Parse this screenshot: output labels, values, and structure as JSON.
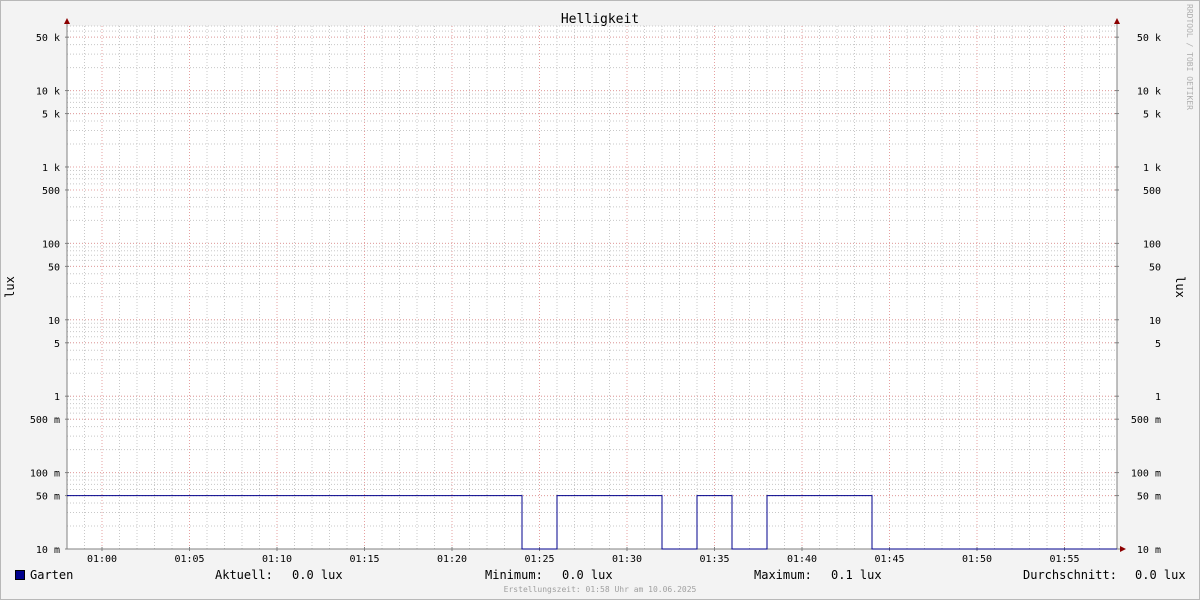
{
  "chart_data": {
    "type": "line",
    "title": "Helligkeit",
    "ylabel_left": "lux",
    "ylabel_right": "lux",
    "y_scale": "log",
    "ylim": [
      0.01,
      70000
    ],
    "y_ticks": [
      {
        "value": 0.01,
        "label": "10 m"
      },
      {
        "value": 0.05,
        "label": "50 m"
      },
      {
        "value": 0.1,
        "label": "100 m"
      },
      {
        "value": 0.5,
        "label": "500 m"
      },
      {
        "value": 1,
        "label": "1"
      },
      {
        "value": 5,
        "label": "5"
      },
      {
        "value": 10,
        "label": "10"
      },
      {
        "value": 50,
        "label": "50"
      },
      {
        "value": 100,
        "label": "100"
      },
      {
        "value": 500,
        "label": "500"
      },
      {
        "value": 1000,
        "label": "1 k"
      },
      {
        "value": 5000,
        "label": "5 k"
      },
      {
        "value": 10000,
        "label": "10 k"
      },
      {
        "value": 50000,
        "label": "50 k"
      }
    ],
    "xlim": [
      "00:58",
      "01:58"
    ],
    "x_ticks": [
      "01:00",
      "01:05",
      "01:10",
      "01:15",
      "01:20",
      "01:25",
      "01:30",
      "01:35",
      "01:40",
      "01:45",
      "01:50",
      "01:55"
    ],
    "grid": true,
    "legend_position": "bottom-left",
    "series": [
      {
        "name": "Garten",
        "color": "#00008c",
        "step": true,
        "points": [
          [
            "00:58",
            0.05
          ],
          [
            "01:24",
            0.05
          ],
          [
            "01:24",
            0.01
          ],
          [
            "01:26",
            0.01
          ],
          [
            "01:26",
            0.05
          ],
          [
            "01:32",
            0.05
          ],
          [
            "01:32",
            0.01
          ],
          [
            "01:34",
            0.01
          ],
          [
            "01:34",
            0.05
          ],
          [
            "01:36",
            0.05
          ],
          [
            "01:36",
            0.01
          ],
          [
            "01:38",
            0.01
          ],
          [
            "01:38",
            0.05
          ],
          [
            "01:44",
            0.05
          ],
          [
            "01:44",
            0.01
          ],
          [
            "01:58",
            0.01
          ]
        ]
      }
    ]
  },
  "legend": {
    "series_label": "Garten",
    "swatch_color": "#00008c",
    "current_label": "Aktuell:",
    "current_value": "0.0 lux",
    "min_label": "Minimum:",
    "min_value": "0.0 lux",
    "max_label": "Maximum:",
    "max_value": "0.1 lux",
    "avg_label": "Durchschnitt:",
    "avg_value": "0.0 lux"
  },
  "footer": "Erstellungszeit: 01:58 Uhr am 10.06.2025",
  "watermark": "RRDTOOL / TOBI OETIKER",
  "colors": {
    "background": "#f3f3f3",
    "canvas": "#ffffff",
    "minor_grid": "#c8c8c8",
    "major_grid": "#e6a0a0",
    "axis": "#808080",
    "arrow": "#8c0000"
  }
}
